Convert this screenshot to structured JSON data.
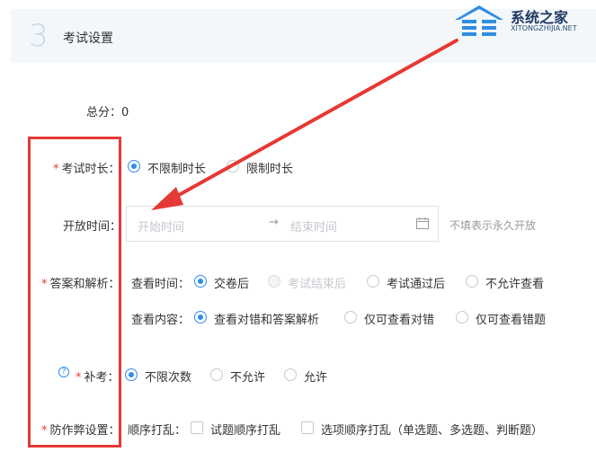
{
  "section": {
    "step": "3",
    "title": "考试设置"
  },
  "watermark": {
    "cn": "系统之家",
    "en": "XITONGZHIJIA.NET"
  },
  "total_score": {
    "label": "总分：",
    "value": "0"
  },
  "duration": {
    "label": "考试时长：",
    "options": [
      "不限制时长",
      "限制时长"
    ],
    "selected": "不限制时长"
  },
  "open_time": {
    "label": "开放时间：",
    "start_placeholder": "开始时间",
    "end_placeholder": "结束时间",
    "separator": "→",
    "hint": "不填表示永久开放"
  },
  "answers": {
    "label": "答案和解析：",
    "view_time": {
      "label": "查看时间：",
      "options": [
        "交卷后",
        "考试结束后",
        "考试通过后",
        "不允许查看"
      ],
      "selected": "交卷后",
      "disabled": [
        "考试结束后"
      ]
    },
    "view_content": {
      "label": "查看内容：",
      "options": [
        "查看对错和答案解析",
        "仅可查看对错",
        "仅可查看错题"
      ],
      "selected": "查看对错和答案解析"
    }
  },
  "retake": {
    "label": "补考：",
    "options": [
      "不限次数",
      "不允许",
      "允许"
    ],
    "selected": "不限次数"
  },
  "anti_cheat": {
    "label": "防作弊设置：",
    "shuffle_label": "顺序打乱：",
    "checks": [
      "试题顺序打乱",
      "选项顺序打乱（单选题、多选题、判断题）"
    ]
  },
  "colors": {
    "accent": "#2d8cf0",
    "annotation": "#e53935"
  },
  "icons": [
    "calendar-icon",
    "help-icon",
    "arrow-icon",
    "house-logo-icon"
  ]
}
